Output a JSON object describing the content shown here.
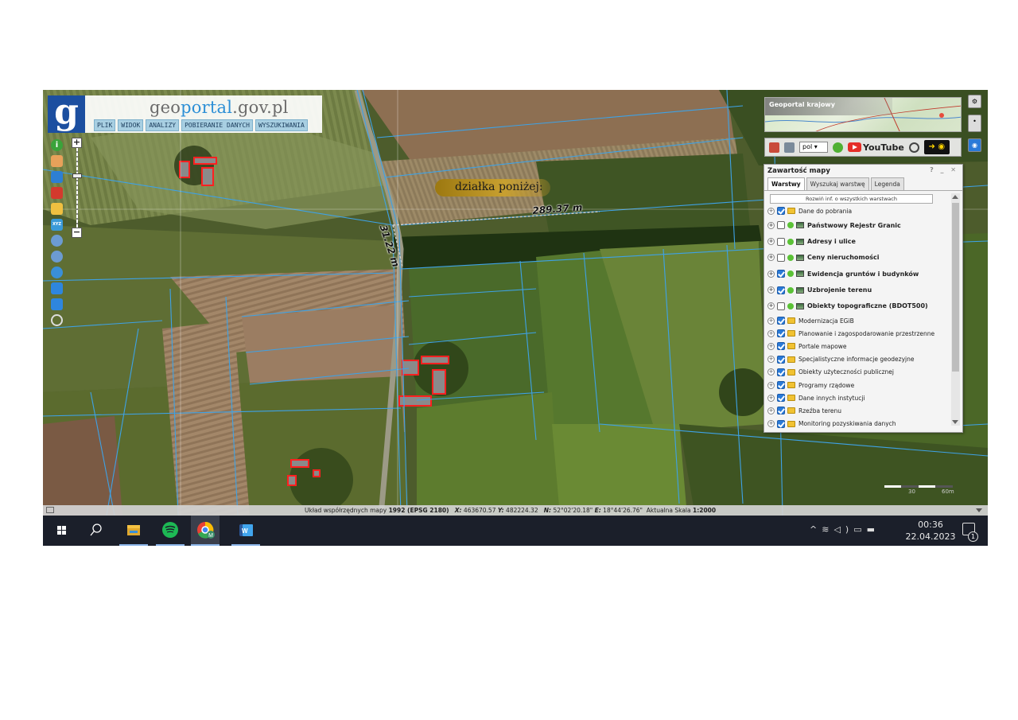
{
  "logo": {
    "brand_g": "g",
    "brand_eo": "eo",
    "brand_portal": "portal",
    "brand_domain": ".gov.pl"
  },
  "menu": [
    "PLIK",
    "WIDOK",
    "ANALIZY",
    "POBIERANIE DANYCH",
    "WYSZUKIWANIA"
  ],
  "map": {
    "pin_label": "działka poniżej:",
    "measurement_1": "289.37 m",
    "measurement_2": "31.22 m"
  },
  "overview": {
    "title": "Geoportal krajowy"
  },
  "right_toolbar": {
    "language": "pol",
    "youtube_label": "YouTube"
  },
  "panel": {
    "title": "Zawartość mapy",
    "controls": "? _ ✕",
    "tabs": [
      "Warstwy",
      "Wyszukaj warstwę",
      "Legenda"
    ],
    "expand_button": "Rozwiń inf. o wszystkich warstwach",
    "layers": [
      {
        "label": "Dane do pobrania",
        "checked": true,
        "kind": "folder",
        "bold": false
      },
      {
        "label": "Państwowy Rejestr Granic",
        "checked": false,
        "kind": "wms",
        "bold": true
      },
      {
        "label": "Adresy i ulice",
        "checked": false,
        "kind": "wms",
        "bold": true
      },
      {
        "label": "Ceny nieruchomości",
        "checked": false,
        "kind": "wms",
        "bold": true
      },
      {
        "label": "Ewidencja gruntów i budynków",
        "checked": true,
        "kind": "wms",
        "bold": true
      },
      {
        "label": "Uzbrojenie terenu",
        "checked": true,
        "kind": "wms",
        "bold": true
      },
      {
        "label": "Obiekty topograficzne (BDOT500)",
        "checked": false,
        "kind": "wms",
        "bold": true
      },
      {
        "label": "Modernizacja EGiB",
        "checked": true,
        "kind": "folder",
        "bold": false
      },
      {
        "label": "Planowanie i zagospodarowanie przestrzenne",
        "checked": true,
        "kind": "folder",
        "bold": false
      },
      {
        "label": "Portale mapowe",
        "checked": true,
        "kind": "folder",
        "bold": false
      },
      {
        "label": "Specjalistyczne informacje geodezyjne",
        "checked": true,
        "kind": "folder",
        "bold": false
      },
      {
        "label": "Obiekty użyteczności publicznej",
        "checked": true,
        "kind": "folder",
        "bold": false
      },
      {
        "label": "Programy rządowe",
        "checked": true,
        "kind": "folder",
        "bold": false
      },
      {
        "label": "Dane innych instytucji",
        "checked": true,
        "kind": "folder",
        "bold": false
      },
      {
        "label": "Rzeźba terenu",
        "checked": true,
        "kind": "folder",
        "bold": false
      },
      {
        "label": "Monitoring pozyskiwania danych",
        "checked": true,
        "kind": "folder",
        "bold": false
      }
    ]
  },
  "scale_bar": {
    "left_label": "30",
    "right_label": "60m"
  },
  "status_bar": {
    "prefix": "Układ współrzędnych mapy ",
    "crs": "1992 (EPSG 2180)",
    "x_label": "X:",
    "x_value": "463670.57",
    "y_label": "Y:",
    "y_value": "482224.32",
    "n_label": "N:",
    "n_value": "52°02'20.18\"",
    "e_label": "E:",
    "e_value": "18°44'26.76\"",
    "scale_label": "Aktualna Skala",
    "scale_value": "1:2000"
  },
  "taskbar": {
    "time": "00:36",
    "date": "22.04.2023",
    "notifications": "1",
    "apps": [
      "start-icon",
      "search-icon",
      "file-explorer-icon",
      "spotify-icon",
      "chrome-icon",
      "word-icon"
    ]
  }
}
